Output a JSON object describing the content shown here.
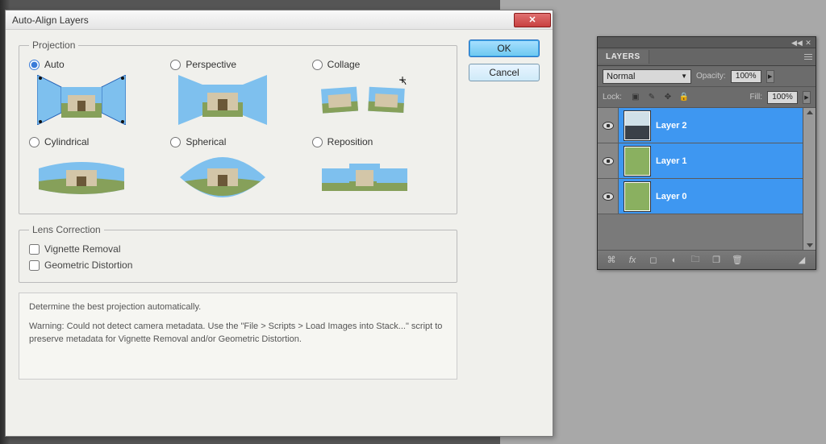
{
  "dialog": {
    "title": "Auto-Align Layers",
    "close_sym": "✕",
    "ok_label": "OK",
    "cancel_label": "Cancel",
    "projection": {
      "legend": "Projection",
      "options": [
        {
          "key": "auto",
          "label": "Auto",
          "checked": true
        },
        {
          "key": "perspective",
          "label": "Perspective",
          "checked": false
        },
        {
          "key": "collage",
          "label": "Collage",
          "checked": false
        },
        {
          "key": "cylindrical",
          "label": "Cylindrical",
          "checked": false
        },
        {
          "key": "spherical",
          "label": "Spherical",
          "checked": false
        },
        {
          "key": "reposition",
          "label": "Reposition",
          "checked": false
        }
      ]
    },
    "lens": {
      "legend": "Lens Correction",
      "vignette": "Vignette Removal",
      "geometric": "Geometric Distortion"
    },
    "desc_title": "Determine the best projection automatically.",
    "desc_warning": "Warning: Could not detect camera metadata. Use the \"File > Scripts > Load Images into Stack...\" script to preserve metadata for Vignette Removal and/or Geometric Distortion."
  },
  "layers_panel": {
    "tab": "LAYERS",
    "blend_mode": "Normal",
    "opacity_label": "Opacity:",
    "opacity_value": "100%",
    "lock_label": "Lock:",
    "fill_label": "Fill:",
    "fill_value": "100%",
    "layers": [
      {
        "name": "Layer 2",
        "thumb": "sky"
      },
      {
        "name": "Layer 1",
        "thumb": "grass"
      },
      {
        "name": "Layer 0",
        "thumb": "grass"
      }
    ]
  }
}
